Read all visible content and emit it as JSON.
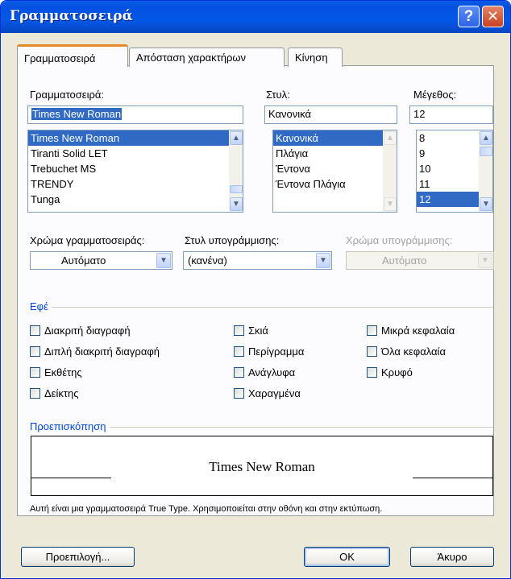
{
  "window": {
    "title": "Γραμματοσειρά"
  },
  "tabs": [
    {
      "label": "Γραμματοσειρά",
      "active": true
    },
    {
      "label": "Απόσταση χαρακτήρων",
      "active": false
    },
    {
      "label": "Κίνηση",
      "active": false
    }
  ],
  "font": {
    "label": "Γραμματοσειρά:",
    "value": "Times New Roman",
    "items": [
      "Times New Roman",
      "Tiranti Solid LET",
      "Trebuchet MS",
      "TRENDY",
      "Tunga"
    ],
    "selected_index": 0
  },
  "style": {
    "label": "Στυλ:",
    "value": "Κανονικά",
    "items": [
      "Κανονικά",
      "Πλάγια",
      "Έντονα",
      "Έντονα Πλάγια"
    ],
    "selected_index": 0
  },
  "size": {
    "label": "Μέγεθος:",
    "value": "12",
    "items": [
      "8",
      "9",
      "10",
      "11",
      "12"
    ],
    "selected_index": 4
  },
  "font_color": {
    "label": "Χρώμα γραμματοσειράς:",
    "value": "Αυτόματο"
  },
  "underline_style": {
    "label": "Στυλ υπογράμμισης:",
    "value": "(κανένα)"
  },
  "underline_color": {
    "label": "Χρώμα υπογράμμισης:",
    "value": "Αυτόματο",
    "disabled": true
  },
  "effects": {
    "title": "Εφέ",
    "col1": [
      "Διακριτή διαγραφή",
      "Διπλή διακριτή διαγραφή",
      "Εκθέτης",
      "Δείκτης"
    ],
    "col2": [
      "Σκιά",
      "Περίγραμμα",
      "Ανάγλυφα",
      "Χαραγμένα"
    ],
    "col3": [
      "Μικρά κεφαλαία",
      "Όλα κεφαλαία",
      "Κρυφό"
    ]
  },
  "preview": {
    "title": "Προεπισκόπηση",
    "sample": "Times New Roman",
    "note": "Αυτή είναι μια γραμματοσειρά True Type. Χρησιμοποιείται στην οθόνη και στην εκτύπωση."
  },
  "buttons": {
    "default": "Προεπιλογή...",
    "ok": "OK",
    "cancel": "Άκυρο"
  },
  "colors": {
    "title_bar": "#0450e0",
    "selection": "#316ac5",
    "group_title": "#0046d5",
    "tab_accent": "#e68b2c"
  }
}
